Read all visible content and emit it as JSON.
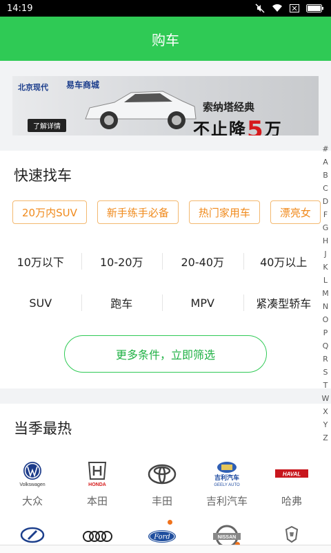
{
  "status": {
    "time": "14:19"
  },
  "header": {
    "title": "购车"
  },
  "banner": {
    "brand_logo": "北京现代",
    "brand_logo2": "易车商城",
    "slogan": "索纳塔经典",
    "headline": "不止降",
    "number": "5",
    "unit": "万",
    "detail": "了解详情"
  },
  "quick": {
    "title": "快速找车",
    "tags": [
      "20万内SUV",
      "新手练手必备",
      "热门家用车",
      "漂亮女"
    ],
    "price_ranges": [
      "10万以下",
      "10-20万",
      "20-40万",
      "40万以上"
    ],
    "body_types": [
      "SUV",
      "跑车",
      "MPV",
      "紧凑型轿车"
    ],
    "more_button": "更多条件，立即筛选"
  },
  "hot": {
    "title": "当季最热",
    "brands": [
      {
        "name": "大众",
        "icon": "volkswagen-logo",
        "logo_text": "Volkswagen"
      },
      {
        "name": "本田",
        "icon": "honda-logo",
        "logo_text": "HONDA"
      },
      {
        "name": "丰田",
        "icon": "toyota-logo",
        "logo_text": ""
      },
      {
        "name": "吉利汽车",
        "icon": "geely-logo",
        "logo_text": "GEELY AUTO"
      },
      {
        "name": "哈弗",
        "icon": "haval-logo",
        "logo_text": "HAVAL"
      }
    ],
    "brands_row2_icons": [
      "hyundai-logo",
      "audi-logo",
      "ford-logo",
      "nissan-logo",
      "baojun-logo"
    ]
  },
  "index_letters": [
    "#",
    "A",
    "B",
    "C",
    "D",
    "F",
    "G",
    "H",
    "J",
    "K",
    "L",
    "M",
    "N",
    "O",
    "P",
    "Q",
    "R",
    "S",
    "T",
    "W",
    "X",
    "Y",
    "Z"
  ],
  "colors": {
    "primary": "#2fca55",
    "tag_orange": "#f08a1c",
    "badge": "#f0721c"
  }
}
